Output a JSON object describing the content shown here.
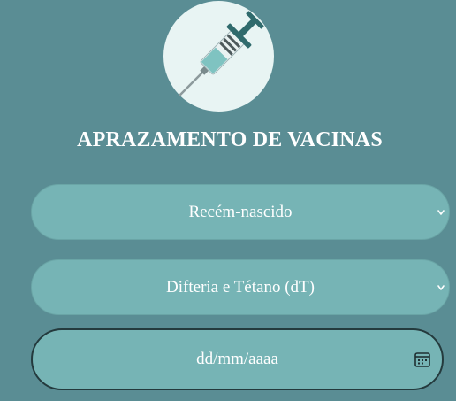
{
  "header": {
    "title": "APRAZAMENTO DE VACINAS",
    "logo_icon": "syringe-icon"
  },
  "form": {
    "age_select": {
      "selected": "Recém-nascido",
      "icon": "chevron-down-icon"
    },
    "vaccine_select": {
      "selected": "Difteria e Tétano (dT)",
      "icon": "chevron-down-icon"
    },
    "date_input": {
      "placeholder": "dd/mm/aaaa",
      "icon": "calendar-icon"
    }
  },
  "colors": {
    "background": "#5a8d94",
    "field": "#76b4b5",
    "logo_circle": "#e8f4f3",
    "text": "#ffffff"
  }
}
